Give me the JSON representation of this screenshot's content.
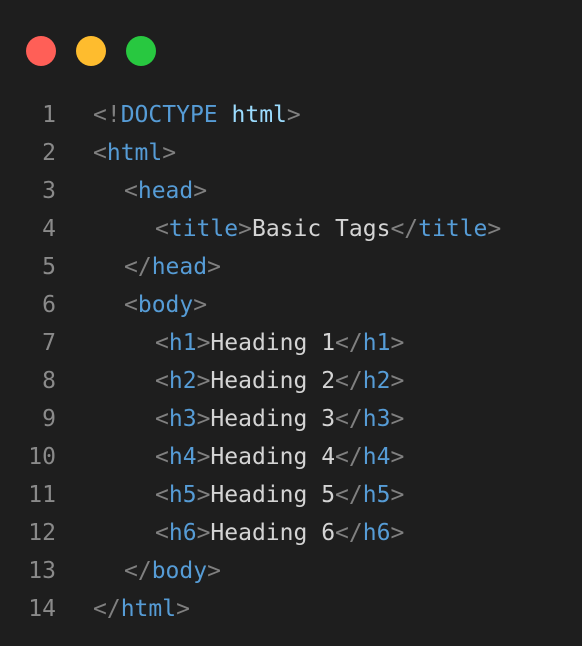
{
  "colors": {
    "background": "#1e1e1e",
    "dot_red": "#ff5f57",
    "dot_yellow": "#febc2e",
    "dot_green": "#28c840",
    "line_number": "#8a8a8a",
    "punctuation": "#808080",
    "tag": "#569cd6",
    "attribute": "#9cdcfe",
    "text": "#d4d4d4"
  },
  "lines": [
    {
      "n": "1",
      "indent": 0,
      "tokens": [
        {
          "c": "p",
          "t": "<!"
        },
        {
          "c": "t",
          "t": "DOCTYPE"
        },
        {
          "c": "x",
          "t": " "
        },
        {
          "c": "a",
          "t": "html"
        },
        {
          "c": "p",
          "t": ">"
        }
      ]
    },
    {
      "n": "2",
      "indent": 0,
      "tokens": [
        {
          "c": "p",
          "t": "<"
        },
        {
          "c": "t",
          "t": "html"
        },
        {
          "c": "p",
          "t": ">"
        }
      ]
    },
    {
      "n": "3",
      "indent": 1,
      "tokens": [
        {
          "c": "p",
          "t": "<"
        },
        {
          "c": "t",
          "t": "head"
        },
        {
          "c": "p",
          "t": ">"
        }
      ]
    },
    {
      "n": "4",
      "indent": 2,
      "tokens": [
        {
          "c": "p",
          "t": "<"
        },
        {
          "c": "t",
          "t": "title"
        },
        {
          "c": "p",
          "t": ">"
        },
        {
          "c": "x",
          "t": "Basic Tags"
        },
        {
          "c": "p",
          "t": "</"
        },
        {
          "c": "t",
          "t": "title"
        },
        {
          "c": "p",
          "t": ">"
        }
      ]
    },
    {
      "n": "5",
      "indent": 1,
      "tokens": [
        {
          "c": "p",
          "t": "</"
        },
        {
          "c": "t",
          "t": "head"
        },
        {
          "c": "p",
          "t": ">"
        }
      ]
    },
    {
      "n": "6",
      "indent": 1,
      "tokens": [
        {
          "c": "p",
          "t": "<"
        },
        {
          "c": "t",
          "t": "body"
        },
        {
          "c": "p",
          "t": ">"
        }
      ]
    },
    {
      "n": "7",
      "indent": 2,
      "tokens": [
        {
          "c": "p",
          "t": "<"
        },
        {
          "c": "t",
          "t": "h1"
        },
        {
          "c": "p",
          "t": ">"
        },
        {
          "c": "x",
          "t": "Heading 1"
        },
        {
          "c": "p",
          "t": "</"
        },
        {
          "c": "t",
          "t": "h1"
        },
        {
          "c": "p",
          "t": ">"
        }
      ]
    },
    {
      "n": "8",
      "indent": 2,
      "tokens": [
        {
          "c": "p",
          "t": "<"
        },
        {
          "c": "t",
          "t": "h2"
        },
        {
          "c": "p",
          "t": ">"
        },
        {
          "c": "x",
          "t": "Heading 2"
        },
        {
          "c": "p",
          "t": "</"
        },
        {
          "c": "t",
          "t": "h2"
        },
        {
          "c": "p",
          "t": ">"
        }
      ]
    },
    {
      "n": "9",
      "indent": 2,
      "tokens": [
        {
          "c": "p",
          "t": "<"
        },
        {
          "c": "t",
          "t": "h3"
        },
        {
          "c": "p",
          "t": ">"
        },
        {
          "c": "x",
          "t": "Heading 3"
        },
        {
          "c": "p",
          "t": "</"
        },
        {
          "c": "t",
          "t": "h3"
        },
        {
          "c": "p",
          "t": ">"
        }
      ]
    },
    {
      "n": "10",
      "indent": 2,
      "tokens": [
        {
          "c": "p",
          "t": "<"
        },
        {
          "c": "t",
          "t": "h4"
        },
        {
          "c": "p",
          "t": ">"
        },
        {
          "c": "x",
          "t": "Heading 4"
        },
        {
          "c": "p",
          "t": "</"
        },
        {
          "c": "t",
          "t": "h4"
        },
        {
          "c": "p",
          "t": ">"
        }
      ]
    },
    {
      "n": "11",
      "indent": 2,
      "tokens": [
        {
          "c": "p",
          "t": "<"
        },
        {
          "c": "t",
          "t": "h5"
        },
        {
          "c": "p",
          "t": ">"
        },
        {
          "c": "x",
          "t": "Heading 5"
        },
        {
          "c": "p",
          "t": "</"
        },
        {
          "c": "t",
          "t": "h5"
        },
        {
          "c": "p",
          "t": ">"
        }
      ]
    },
    {
      "n": "12",
      "indent": 2,
      "tokens": [
        {
          "c": "p",
          "t": "<"
        },
        {
          "c": "t",
          "t": "h6"
        },
        {
          "c": "p",
          "t": ">"
        },
        {
          "c": "x",
          "t": "Heading 6"
        },
        {
          "c": "p",
          "t": "</"
        },
        {
          "c": "t",
          "t": "h6"
        },
        {
          "c": "p",
          "t": ">"
        }
      ]
    },
    {
      "n": "13",
      "indent": 1,
      "tokens": [
        {
          "c": "p",
          "t": "</"
        },
        {
          "c": "t",
          "t": "body"
        },
        {
          "c": "p",
          "t": ">"
        }
      ]
    },
    {
      "n": "14",
      "indent": 0,
      "tokens": [
        {
          "c": "p",
          "t": "</"
        },
        {
          "c": "t",
          "t": "html"
        },
        {
          "c": "p",
          "t": ">"
        }
      ]
    }
  ]
}
